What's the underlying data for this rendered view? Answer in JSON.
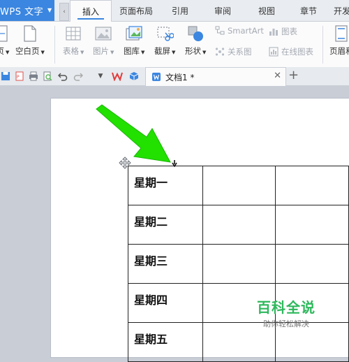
{
  "app": {
    "name": "WPS 文字"
  },
  "menu_tabs": [
    {
      "label": "插入",
      "active": true
    },
    {
      "label": "页面布局"
    },
    {
      "label": "引用"
    },
    {
      "label": "审阅"
    },
    {
      "label": "视图"
    },
    {
      "label": "章节"
    },
    {
      "label": "开发"
    }
  ],
  "ribbon": {
    "cut_left_label": "页",
    "blank_page": "空白页",
    "table": "表格",
    "picture": "图片",
    "gallery": "图库",
    "screenshot": "截屏",
    "shapes": "形状",
    "smartart": "SmartArt",
    "chart": "图表",
    "relation_chart": "关系图",
    "online_chart": "在线图表",
    "header_footer": "页眉和"
  },
  "document_tab": {
    "title": "文档1 *"
  },
  "doc_table": {
    "rows": [
      [
        "星期一",
        "",
        ""
      ],
      [
        "星期二",
        "",
        ""
      ],
      [
        "星期三",
        "",
        ""
      ],
      [
        "星期四",
        "",
        ""
      ],
      [
        "星期五",
        "",
        ""
      ]
    ]
  },
  "watermark": {
    "title": "百科全说",
    "subtitle": "助你轻松解决"
  },
  "colors": {
    "accent": "#3b86e0",
    "arrow": "#22e000",
    "watermark": "#2eb85c"
  }
}
